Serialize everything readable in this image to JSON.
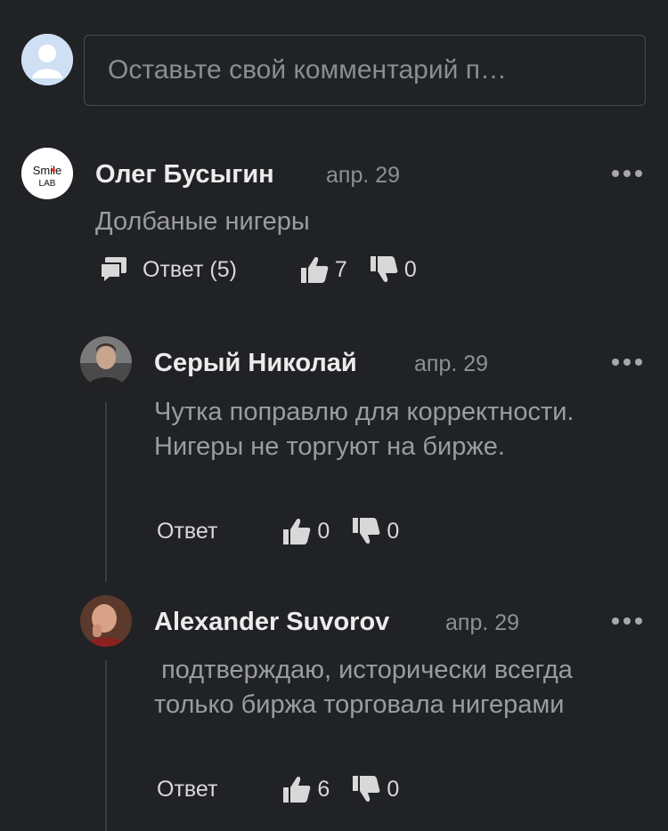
{
  "composer": {
    "placeholder": "Оставьте свой комментарий п…"
  },
  "comments": [
    {
      "author": "Олег Бусыгин",
      "date": "апр. 29",
      "avatar_text_top": "Smile",
      "avatar_text_bottom": "LAB",
      "text": "Долбаные нигеры",
      "reply_label": "Ответ (5)",
      "likes": "7",
      "dislikes": "0"
    },
    {
      "author": "Серый Николай",
      "date": "апр. 29",
      "text": "Чутка поправлю для корректности. Нигеры не торгуют на бирже.",
      "reply_label": "Ответ",
      "likes": "0",
      "dislikes": "0"
    },
    {
      "author": "Alexander Suvorov",
      "date": "апр. 29",
      "text": " подтверждаю, исторически всегда только биржа торговала нигерами",
      "reply_label": "Ответ",
      "likes": "6",
      "dislikes": "0"
    }
  ],
  "colors": {
    "background": "#202225",
    "border": "#474a4f",
    "text_primary": "#ececec",
    "text_secondary": "#9a9ca0"
  },
  "icons": {
    "reply": "speech-bubble-icon",
    "like": "thumbs-up-icon",
    "dislike": "thumbs-down-icon",
    "more": "ellipsis-icon"
  }
}
